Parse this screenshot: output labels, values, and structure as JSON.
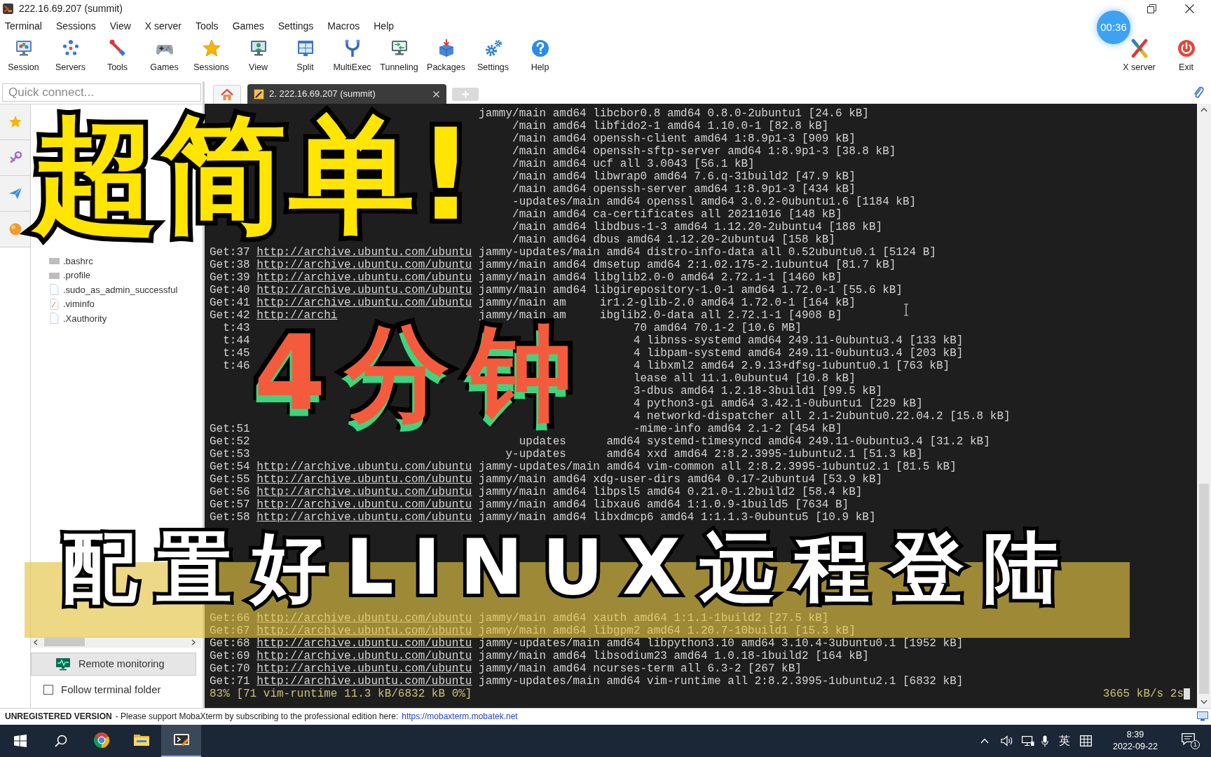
{
  "window": {
    "title": "222.16.69.207 (summit)"
  },
  "recording_timer": "00:36",
  "menu": [
    "Terminal",
    "Sessions",
    "View",
    "X server",
    "Tools",
    "Games",
    "Settings",
    "Macros",
    "Help"
  ],
  "toolbar": [
    "Session",
    "Servers",
    "Tools",
    "Games",
    "Sessions",
    "View",
    "Split",
    "MultiExec",
    "Tunneling",
    "Packages",
    "Settings",
    "Help"
  ],
  "toolbar_right": [
    "X server",
    "Exit"
  ],
  "quick_connect": {
    "placeholder": "Quick connect..."
  },
  "tabs": [
    {
      "kind": "home",
      "selected": false
    },
    {
      "kind": "session",
      "label": "2. 222.16.69.207 (summit)",
      "selected": true
    }
  ],
  "sidebar": {
    "files": [
      {
        "name": ".bashrc",
        "kind": "config"
      },
      {
        "name": ".profile",
        "kind": "config"
      },
      {
        "name": ".sudo_as_admin_successful",
        "kind": "doc"
      },
      {
        "name": ".viminfo",
        "kind": "edited"
      },
      {
        "name": ".Xauthority",
        "kind": "doc"
      }
    ],
    "remote_monitoring": "Remote monitoring",
    "follow_terminal_folder": {
      "label": "Follow terminal folder",
      "checked": false
    }
  },
  "terminal": {
    "upper_lines": [
      {
        "text": "jammy/main amd64 libcbor0.8 amd64 0.8.0-2ubuntu1 [24.6 kB]"
      },
      {
        "text": "/main amd64 libfido2-1 amd64 1.10.0-1 [82.8 kB]"
      },
      {
        "text": "/main amd64 openssh-client amd64 1:8.9p1-3 [909 kB]"
      },
      {
        "text": "/main amd64 openssh-sftp-server amd64 1:8.9p1-3 [38.8 kB]"
      },
      {
        "text": "/main amd64 ucf all 3.0043 [56.1 kB]"
      },
      {
        "text": "/main amd64 libwrap0 amd64 7.6.q-31build2 [47.9 kB]"
      },
      {
        "text": "/main amd64 openssh-server amd64 1:8.9p1-3 [434 kB]"
      },
      {
        "text": "-updates/main amd64 openssl amd64 3.0.2-0ubuntu1.6 [1184 kB]"
      },
      {
        "text": "/main amd64 ca-certificates all 20211016 [148 kB]"
      },
      {
        "text": "/main amd64 libdbus-1-3 amd64 1.12.20-2ubuntu4 [188 kB]"
      },
      {
        "text": "/main amd64 dbus amd64 1.12.20-2ubuntu4 [158 kB]"
      },
      {
        "get": "Get:37",
        "url": "http://archive.ubuntu.com/ubuntu",
        "text": "jammy-updates/main amd64 distro-info-data all 0.52ubuntu0.1 [5124 B]"
      },
      {
        "get": "Get:38",
        "url": "http://archive.ubuntu.com/ubuntu",
        "text": "jammy/main amd64 dmsetup amd64 2:1.02.175-2.1ubuntu4 [81.7 kB]"
      },
      {
        "get": "Get:39",
        "url": "http://archive.ubuntu.com/ubuntu",
        "text": "jammy/main amd64 libglib2.0-0 amd64 2.72.1-1 [1460 kB]"
      },
      {
        "get": "Get:40",
        "url": "http://archive.ubuntu.com/ubuntu",
        "text": "jammy/main amd64 libgirepository-1.0-1 amd64 1.72.0-1 [55.6 kB]"
      },
      {
        "get": "Get:41",
        "url": "http://archive.ubuntu.com/ubuntu",
        "text": "jammy/main am",
        "text_2": "ir1.2-glib-2.0 amd64 1.72.0-1 [164 kB]"
      },
      {
        "get": "Get:42",
        "url": "http://archi",
        "text": "jammy/main am",
        "text_2": "ibglib2.0-data all 2.72.1-1 [4908 B]"
      },
      {
        "get": "t:43",
        "text": "70 amd64 70.1-2 [10.6 MB]"
      },
      {
        "get": "t:44",
        "text": "4 libnss-systemd amd64 249.11-0ubuntu3.4 [133 kB]"
      },
      {
        "get": "t:45",
        "text": "4 libpam-systemd amd64 249.11-0ubuntu3.4 [203 kB]"
      },
      {
        "get": "t:46",
        "text": "4 libxml2 amd64 2.9.13+dfsg-1ubuntu0.1 [763 kB]"
      },
      {
        "text": "lease all 11.1.0ubuntu4 [10.8 kB]"
      },
      {
        "text": "3-dbus amd64 1.2.18-3build1 [99.5 kB]"
      },
      {
        "text": "4 python3-gi amd64 3.42.1-0ubuntu1 [229 kB]"
      },
      {
        "text": "4 networkd-dispatcher all 2.1-2ubuntu0.22.04.2 [15.8 kB]"
      },
      {
        "get": "Get:51",
        "text": "-mime-info amd64 2.1-2 [454 kB]"
      },
      {
        "get": "Get:52",
        "text": "updates",
        "text_2": "amd64 systemd-timesyncd amd64 249.11-0ubuntu3.4 [31.2 kB]"
      },
      {
        "get": "Get:53",
        "text": "y-updates",
        "text_2": "amd64 xxd amd64 2:8.2.3995-1ubuntu2.1 [51.3 kB]"
      },
      {
        "get": "Get:54",
        "url": "http://archive.ubuntu.com/ubuntu",
        "text": "jammy-updates/main amd64 vim-common all 2:8.2.3995-1ubuntu2.1 [81.5 kB]"
      },
      {
        "get": "Get:55",
        "url": "http://archive.ubuntu.com/ubuntu",
        "text": "jammy/main amd64 xdg-user-dirs amd64 0.17-2ubuntu4 [53.9 kB]"
      },
      {
        "get": "Get:56",
        "url": "http://archive.ubuntu.com/ubuntu",
        "text": "jammy/main amd64 libpsl5 amd64 0.21.0-1.2build2 [58.4 kB]"
      },
      {
        "get": "Get:57",
        "url": "http://archive.ubuntu.com/ubuntu",
        "text": "jammy/main amd64 libxau6 amd64 1:1.0.9-1build5 [7634 B]"
      },
      {
        "get": "Get:58",
        "url": "http://archive.ubuntu.com/ubuntu",
        "text": "jammy/main amd64 libxdmcp6 amd64 1:1.1.3-0ubuntu5 [10.9 kB]"
      }
    ],
    "lower_lines": [
      {
        "get": "Get:66",
        "url": "http://archive.ubuntu.com/ubuntu",
        "text": "jammy/main amd64 xauth amd64 1:1.1-1build2 [27.5 kB]"
      },
      {
        "get": "Get:67",
        "url": "http://archive.ubuntu.com/ubuntu",
        "text": "jammy/main amd64 libgpm2 amd64 1.20.7-10build1 [15.3 kB]"
      },
      {
        "get": "Get:68",
        "url": "http://archive.ubuntu.com/ubuntu",
        "text": "jammy-updates/main amd64 libpython3.10 amd64 3.10.4-3ubuntu0.1 [1952 kB]"
      },
      {
        "get": "Get:69",
        "url": "http://archive.ubuntu.com/ubuntu",
        "text": "jammy/main amd64 libsodium23 amd64 1.0.18-1build2 [164 kB]"
      },
      {
        "get": "Get:70",
        "url": "http://archive.ubuntu.com/ubuntu",
        "text": "jammy/main amd64 ncurses-term all 6.3-2 [267 kB]"
      },
      {
        "get": "Get:71",
        "url": "http://archive.ubuntu.com/ubuntu",
        "text": "jammy-updates/main amd64 vim-runtime all 2:8.2.3995-1ubuntu2.1 [6832 kB]"
      }
    ],
    "progress": "83% [71 vim-runtime 11.3 kB/6832 kB 0%]",
    "speed": "3665 kB/s 2s"
  },
  "overlay": {
    "headline": "超简单!",
    "duration": "4分钟",
    "caption": "配置好LINUX远程登陆"
  },
  "status_bar": {
    "label": "UNREGISTERED VERSION",
    "message": "- Please support MobaXterm by subscribing to the professional edition here:",
    "link": "https://mobaxterm.mobatek.net"
  },
  "taskbar": {
    "apps": [
      {
        "selected": false
      },
      {
        "selected": false
      },
      {
        "selected": true
      }
    ],
    "input_method": "英",
    "time": "8:39",
    "date": "2022-09-22",
    "notifications": "1"
  }
}
